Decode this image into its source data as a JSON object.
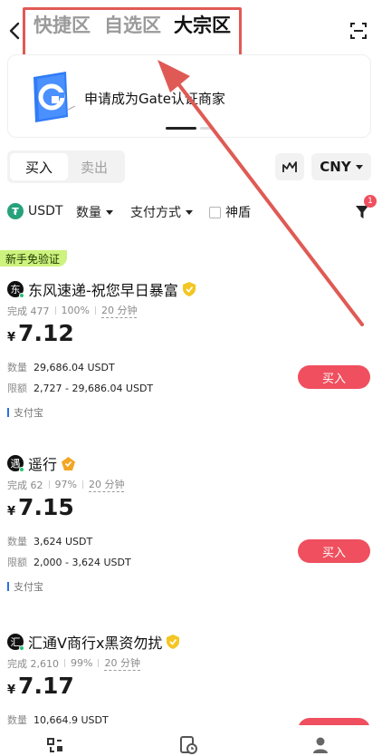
{
  "header": {
    "tabs": [
      {
        "label": "快捷区",
        "active": false
      },
      {
        "label": "自选区",
        "active": false
      },
      {
        "label": "大宗区",
        "active": true
      }
    ]
  },
  "banner": {
    "text": "申请成为Gate认证商家"
  },
  "trade": {
    "buy_label": "买入",
    "sell_label": "卖出",
    "currency": "CNY"
  },
  "filters": {
    "coin": "USDT",
    "amount": "数量",
    "payment": "支付方式",
    "shield": "神盾",
    "badge_count": "1"
  },
  "new_badge": "新手免验证",
  "merchants": [
    {
      "avatar_char": "东",
      "name": "东风速递-祝您早日暴富",
      "completed_label": "完成",
      "completed": "477",
      "rate": "100%",
      "time": "20 分钟",
      "currency_symbol": "¥",
      "price": "7.12",
      "amount_label": "数量",
      "amount": "29,686.04 USDT",
      "limit_label": "限额",
      "limit": "2,727 - 29,686.04 USDT",
      "payment": "支付宝",
      "buy_label": "买入"
    },
    {
      "avatar_char": "遇",
      "name": "遥行",
      "completed_label": "完成",
      "completed": "62",
      "rate": "97%",
      "time": "20 分钟",
      "currency_symbol": "¥",
      "price": "7.15",
      "amount_label": "数量",
      "amount": "3,624 USDT",
      "limit_label": "限额",
      "limit": "2,000 - 3,624 USDT",
      "payment": "支付宝",
      "buy_label": "买入"
    },
    {
      "avatar_char": "汇",
      "name": "汇通V商行x黑资勿扰",
      "completed_label": "完成",
      "completed": "2,610",
      "rate": "99%",
      "time": "20 分钟",
      "currency_symbol": "¥",
      "price": "7.17",
      "amount_label": "数量",
      "amount": "10,664.9 USDT"
    }
  ],
  "colors": {
    "accent_red": "#ef4f5e",
    "annotation_red": "#e05a55",
    "badge_green": "#cdf27e",
    "usdt_green": "#26a17b"
  }
}
